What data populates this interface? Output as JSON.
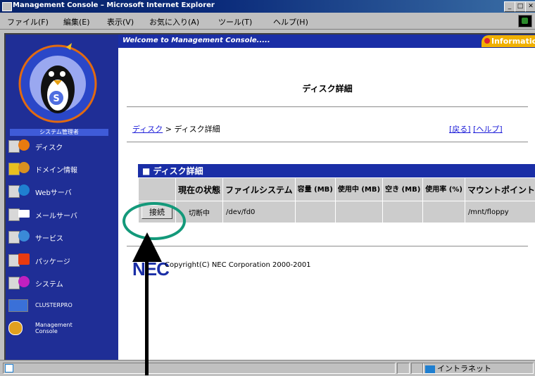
{
  "window": {
    "title": "Management Console – Microsoft Internet Explorer",
    "controls": [
      "_",
      "□",
      "✕"
    ]
  },
  "menubar": {
    "items": [
      "ファイル(F)",
      "編集(E)",
      "表示(V)",
      "お気に入り(A)",
      "ツール(T)",
      "ヘルプ(H)"
    ]
  },
  "sidebar": {
    "logo_text": "Management Console",
    "system_badge": "システム管理者",
    "items": [
      {
        "label": "ディスク",
        "icon": "disk-icon",
        "color": "#e87a10"
      },
      {
        "label": "ドメイン情報",
        "icon": "domain-icon",
        "color": "#d89020"
      },
      {
        "label": "Webサーバ",
        "icon": "web-server-icon",
        "color": "#1f7fd0"
      },
      {
        "label": "メールサーバ",
        "icon": "mail-server-icon",
        "color": "#ffffff"
      },
      {
        "label": "サービス",
        "icon": "service-icon",
        "color": "#3a8ad8"
      },
      {
        "label": "パッケージ",
        "icon": "package-icon",
        "color": "#e83a10"
      },
      {
        "label": "システム",
        "icon": "system-icon",
        "color": "#c020c0"
      },
      {
        "label": "CLUSTERPRO",
        "icon": "clusterpro-icon",
        "color": "#3a70d8"
      },
      {
        "label": "Management Console",
        "icon": "management-console-icon",
        "color": "#e0a020"
      }
    ]
  },
  "header": {
    "welcome": "Welcome to Management Console.....",
    "info_tab": "Information"
  },
  "main": {
    "title": "ディスク詳細",
    "breadcrumb": {
      "parent": "ディスク",
      "separator": " > ",
      "current": "ディスク詳細"
    },
    "back_link": "[戻る]",
    "help_link": "[ヘルプ]",
    "table": {
      "caption": "■ ディスク詳細",
      "columns": [
        "",
        "現在の状態",
        "ファイルシステム",
        "容量 (MB)",
        "使用中 (MB)",
        "空き (MB)",
        "使用率 (%)",
        "マウントポイント"
      ],
      "rows": [
        {
          "action": "接続",
          "status": "切断中",
          "filesystem": "/dev/fd0",
          "capacity": "",
          "used": "",
          "free": "",
          "usage": "",
          "mount": "/mnt/floppy"
        }
      ]
    },
    "footer": {
      "logo": "NEC",
      "copyright": "Copyright(C) NEC Corporation 2000-2001"
    }
  },
  "statusbar": {
    "zone": "イントラネット"
  },
  "colors": {
    "nav_bg": "#1f2e96",
    "header_bg": "#1a2ea6",
    "info_tab": "#f0b000",
    "link": "#1c1cd8",
    "highlight_ring": "#13997a"
  }
}
